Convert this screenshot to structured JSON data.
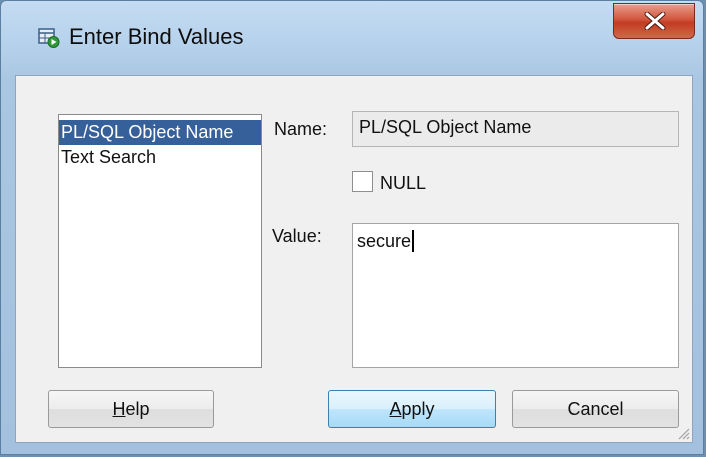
{
  "window": {
    "title": "Enter Bind Values",
    "title_icon": "bind-values-window-icon",
    "close_icon": "close-icon"
  },
  "bind_list": {
    "items": [
      {
        "label": "PL/SQL Object Name",
        "selected": true
      },
      {
        "label": "Text Search",
        "selected": false
      }
    ]
  },
  "form": {
    "name_label": "Name:",
    "name_value": "PL/SQL Object Name",
    "null_label": "NULL",
    "null_checked": false,
    "value_label": "Value:",
    "value_text": "secure"
  },
  "buttons": {
    "help_label": "Help",
    "help_mnemonic": "H",
    "help_rest": "elp",
    "apply_label": "Apply",
    "apply_mnemonic": "A",
    "apply_rest": "pply",
    "cancel_label": "Cancel"
  },
  "colors": {
    "selection": "#36609a",
    "close_button": "#c23c22",
    "default_button_border": "#3c7fb1"
  }
}
